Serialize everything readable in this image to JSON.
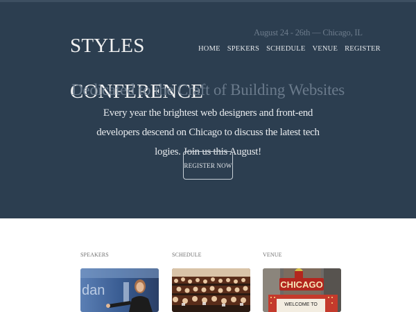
{
  "header": {
    "logo_line1": "STYLES",
    "logo_line2": "CONFERENCE",
    "event_info": "August 24 - 26th — Chicago, IL",
    "nav": [
      {
        "label": "HOME"
      },
      {
        "label": "SPEKERS"
      },
      {
        "label": "SCHEDULE"
      },
      {
        "label": "VENUE"
      },
      {
        "label": "REGISTER"
      }
    ]
  },
  "hero": {
    "headline": "Dedicated to the Craft of Building Websites",
    "lead": "Every year the brightest web designers and front-end developers descend on Chicago to discuss the latest tech logies. Join us this August!",
    "cta_label": "REGISTER NOW"
  },
  "cards": [
    {
      "label": "SPEAKERS",
      "image": "speaker-photo"
    },
    {
      "label": "SCHEDULE",
      "image": "audience-photo"
    },
    {
      "label": "VENUE",
      "image": "chicago-theatre-photo",
      "sign_text": "CHICAGO",
      "marquee_text": "WELCOME TO"
    }
  ],
  "colors": {
    "hero_bg": "#2c3e50",
    "muted_text": "#6a7a8b",
    "light_text": "#e8ebee"
  }
}
